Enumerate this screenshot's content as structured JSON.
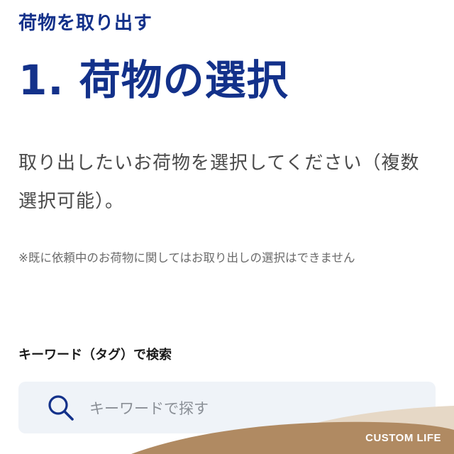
{
  "header": {
    "section_label": "荷物を取り出す",
    "step_title": "1. 荷物の選択"
  },
  "body": {
    "instruction": "取り出したいお荷物を選択してください（複数選択可能）。",
    "note": "※既に依頼中のお荷物に関してはお取り出しの選択はできません"
  },
  "search": {
    "label": "キーワード（タグ）で検索",
    "placeholder": "キーワードで探す",
    "icon": "search-icon"
  },
  "branding": {
    "watermark": "CUSTOM LIFE"
  },
  "colors": {
    "accent": "#13318a",
    "search_bg": "#eff3f8",
    "wave_tan": "#b08a62",
    "wave_light": "#e6d8c6"
  }
}
